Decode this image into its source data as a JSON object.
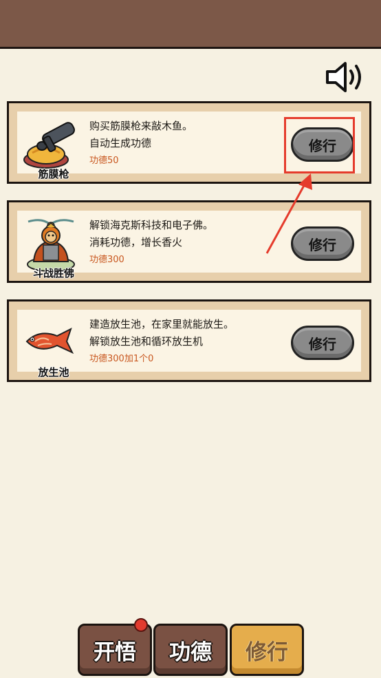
{
  "header": {
    "sound_icon": "speaker-volume-icon"
  },
  "upgrades": [
    {
      "name": "筋膜枪",
      "icon": "massage-gun-icon",
      "desc_line1": "购买筋膜枪来敲木鱼。",
      "desc_line2": "自动生成功德",
      "cost": "功德50",
      "button_label": "修行"
    },
    {
      "name": "斗战胜佛",
      "icon": "monkey-buddha-icon",
      "desc_line1": "解锁海克斯科技和电子佛。",
      "desc_line2": "消耗功德，增长香火",
      "cost": "功德300",
      "button_label": "修行"
    },
    {
      "name": "放生池",
      "icon": "koi-fish-icon",
      "desc_line1": "建造放生池，在家里就能放生。",
      "desc_line2": "解锁放生池和循环放生机",
      "cost": "功德300加1个0",
      "button_label": "修行"
    }
  ],
  "annotation": {
    "highlight_color": "#e53b2c"
  },
  "bottom_nav": {
    "tab1": "开悟",
    "tab2": "功德",
    "tab3": "修行",
    "active": "修行",
    "badge_color": "#e23b2e"
  }
}
